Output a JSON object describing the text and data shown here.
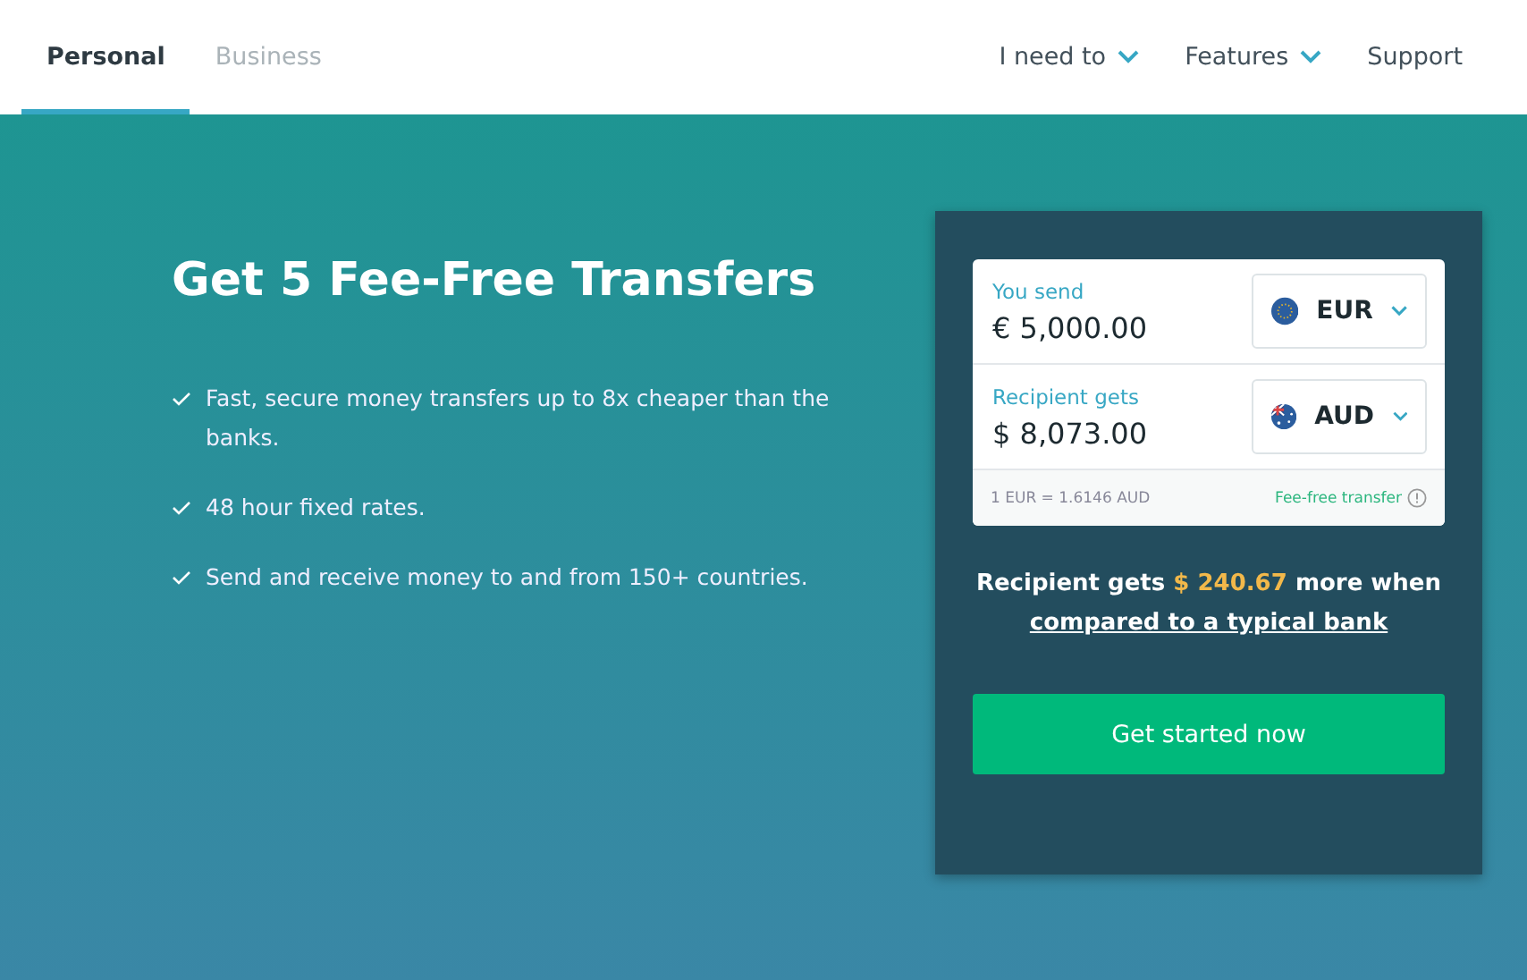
{
  "tabs": [
    {
      "label": "Personal",
      "selected": true
    },
    {
      "label": "Business",
      "selected": false
    }
  ],
  "menu": [
    {
      "label": "I need to",
      "kind": "dropdown"
    },
    {
      "label": "Features",
      "kind": "dropdown"
    },
    {
      "label": "Support",
      "kind": "link"
    }
  ],
  "hero": {
    "title": "Get 5 Fee-Free Transfers",
    "points": [
      "Fast, secure money transfers up to 8x cheaper than the banks.",
      "48 hour fixed rates.",
      "Send and receive money to and from 150+ countries."
    ]
  },
  "calculator": {
    "rows": [
      {
        "label": "You send",
        "amount": "€ 5,000.00",
        "currency": "EUR",
        "kind": "eu"
      },
      {
        "label": "Recipient gets",
        "amount": "$ 8,073.00",
        "currency": "AUD",
        "kind": "au"
      }
    ],
    "rate": "1 EUR = 1.6146 AUD",
    "fee_note": "Fee-free transfer",
    "savings": {
      "before": "Recipient gets",
      "amount": "$ 240.67",
      "after": "more when",
      "link": "compared to a typical bank"
    },
    "button": "Get started now"
  }
}
